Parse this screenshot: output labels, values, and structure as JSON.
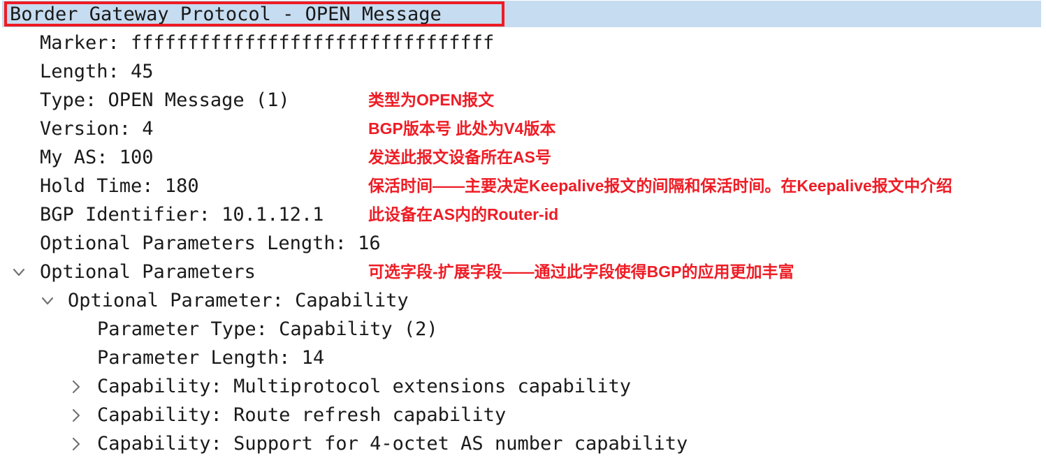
{
  "colors": {
    "annotation_red": "#ee1c25",
    "selection_blue": "#c6dcf0",
    "text": "#1a1a1a",
    "twisty_gray": "#707070",
    "background": "#ffffff"
  },
  "tree": {
    "root": {
      "label": "Border Gateway Protocol - OPEN Message",
      "selected": true,
      "highlight_box": true
    },
    "rows": [
      {
        "id": "marker",
        "label": "Marker: ffffffffffffffffffffffffffffffff",
        "indent": 1,
        "twisty": "none",
        "annotation": ""
      },
      {
        "id": "length",
        "label": "Length: 45",
        "indent": 1,
        "twisty": "none",
        "annotation": ""
      },
      {
        "id": "type",
        "label": "Type: OPEN Message (1)",
        "indent": 1,
        "twisty": "none",
        "annotation": "类型为OPEN报文"
      },
      {
        "id": "version",
        "label": "Version: 4",
        "indent": 1,
        "twisty": "none",
        "annotation": "BGP版本号  此处为V4版本"
      },
      {
        "id": "my-as",
        "label": "My AS: 100",
        "indent": 1,
        "twisty": "none",
        "annotation": "发送此报文设备所在AS号"
      },
      {
        "id": "hold-time",
        "label": "Hold Time: 180",
        "indent": 1,
        "twisty": "none",
        "annotation": "保活时间——主要决定Keepalive报文的间隔和保活时间。在Keepalive报文中介绍"
      },
      {
        "id": "bgp-identifier",
        "label": "BGP Identifier: 10.1.12.1",
        "indent": 1,
        "twisty": "none",
        "annotation": "此设备在AS内的Router-id"
      },
      {
        "id": "optional-parameters-length",
        "label": "Optional Parameters Length: 16",
        "indent": 1,
        "twisty": "none",
        "annotation": ""
      },
      {
        "id": "optional-parameters",
        "label": "Optional Parameters",
        "indent": 1,
        "twisty": "expanded",
        "annotation": "可选字段-扩展字段——通过此字段使得BGP的应用更加丰富"
      },
      {
        "id": "optional-parameter-capability",
        "label": "Optional Parameter: Capability",
        "indent": 2,
        "twisty": "expanded",
        "annotation": ""
      },
      {
        "id": "parameter-type",
        "label": "Parameter Type: Capability (2)",
        "indent": 3,
        "twisty": "none",
        "annotation": ""
      },
      {
        "id": "parameter-length",
        "label": "Parameter Length: 14",
        "indent": 3,
        "twisty": "none",
        "annotation": ""
      },
      {
        "id": "capability-multiprotocol",
        "label": "Capability: Multiprotocol extensions capability",
        "indent": 3,
        "twisty": "collapsed",
        "annotation": ""
      },
      {
        "id": "capability-route-refresh",
        "label": "Capability: Route refresh capability",
        "indent": 3,
        "twisty": "collapsed",
        "annotation": ""
      },
      {
        "id": "capability-4-octet-as",
        "label": "Capability: Support for 4-octet AS number capability",
        "indent": 3,
        "twisty": "collapsed",
        "annotation": ""
      }
    ]
  }
}
